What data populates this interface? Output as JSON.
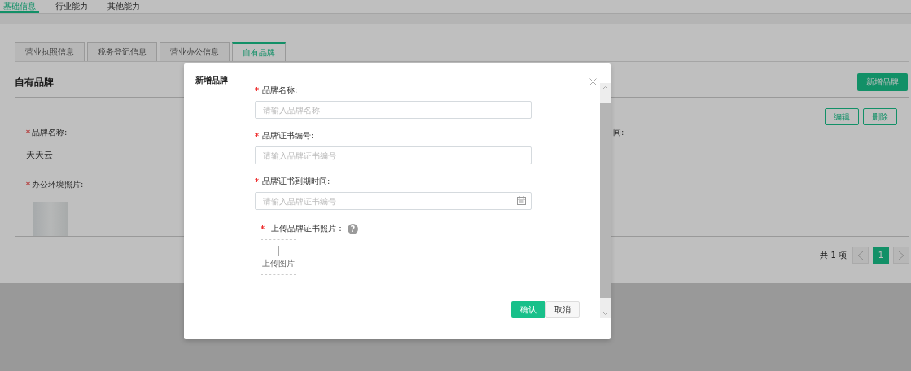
{
  "top_tabs": [
    {
      "label": "基础信息",
      "selected": true
    },
    {
      "label": "行业能力",
      "selected": false
    },
    {
      "label": "其他能力",
      "selected": false
    }
  ],
  "section_tabs": [
    {
      "label": "营业执照信息",
      "selected": false
    },
    {
      "label": "税务登记信息",
      "selected": false
    },
    {
      "label": "营业办公信息",
      "selected": false
    },
    {
      "label": "自有品牌",
      "selected": true
    }
  ],
  "section_title": "自有品牌",
  "add_button": "新增品牌",
  "card": {
    "edit_button": "编辑",
    "delete_button": "删除",
    "fields": [
      {
        "label": "品牌名称:",
        "required": true,
        "value": "天天云"
      }
    ],
    "partial_label": "间:",
    "photo_label": "办公环境照片:",
    "photo_required": true
  },
  "pagination": {
    "total": "共 1 项",
    "pages": [
      {
        "label": "1",
        "selected": true
      }
    ]
  },
  "modal": {
    "title": "新增品牌",
    "fields": [
      {
        "kind": "text",
        "label": "品牌名称:",
        "required": true,
        "placeholder": "请输入品牌名称"
      },
      {
        "kind": "text",
        "label": "品牌证书编号:",
        "required": true,
        "placeholder": "请输入品牌证书编号"
      },
      {
        "kind": "date",
        "label": "品牌证书到期时间:",
        "required": true,
        "placeholder": "请输入品牌证书编号"
      }
    ],
    "upload": {
      "label": "上传品牌证书照片：",
      "required": true,
      "help": "?",
      "button": "上传图片"
    },
    "confirm": "确认",
    "cancel": "取消"
  }
}
